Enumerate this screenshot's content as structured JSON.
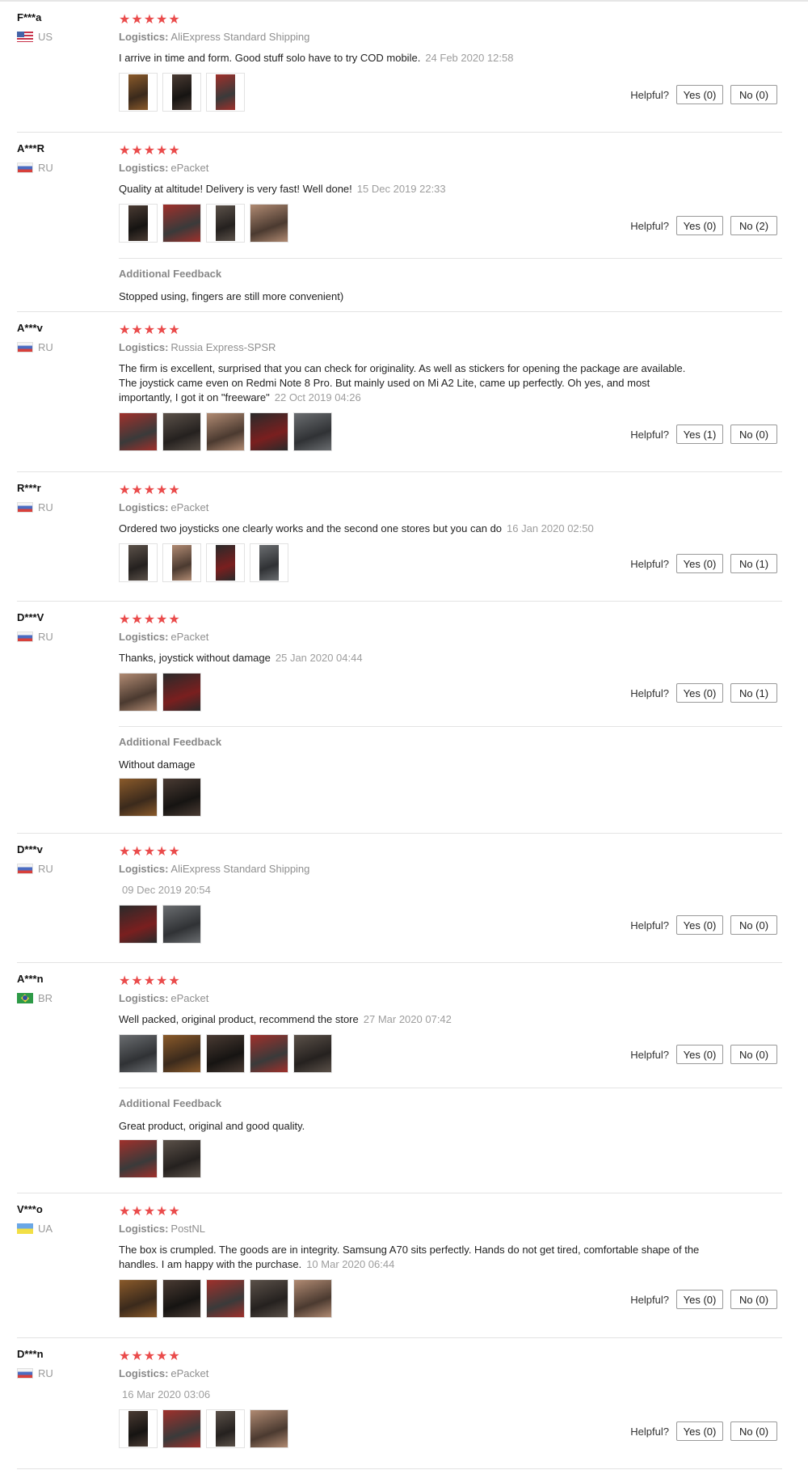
{
  "labels": {
    "logistics": "Logistics:",
    "helpful": "Helpful?",
    "additional_feedback": "Additional Feedback"
  },
  "colors": {
    "star": "#ea4b4b",
    "muted_text": "#9d9d9d",
    "divider": "#e3e3e3"
  },
  "reviews": [
    {
      "user": "F***a",
      "country": "US",
      "rating": 5,
      "logistics": "AliExpress Standard Shipping",
      "text": "I arrive in time and form. Good stuff solo have to try COD mobile.",
      "date": "24 Feb 2020 12:58",
      "photo_count": 3,
      "yes": "Yes (0)",
      "no": "No (0)"
    },
    {
      "user": "A***R",
      "country": "RU",
      "rating": 5,
      "logistics": "ePacket",
      "text": "Quality at altitude! Delivery is very fast! Well done!",
      "date": "15 Dec 2019 22:33",
      "photo_count": 4,
      "yes": "Yes (0)",
      "no": "No (2)",
      "additional": {
        "text": "Stopped using, fingers are still more convenient)",
        "photo_count": 0
      }
    },
    {
      "user": "A***v",
      "country": "RU",
      "rating": 5,
      "logistics": "Russia Express-SPSR",
      "text": "The firm is excellent, surprised that you can check for originality. As well as stickers for opening the package are available. The joystick came even on Redmi Note 8 Pro. But mainly used on Mi A2 Lite, came up perfectly. Oh yes, and most importantly, I got it on \"freeware\"",
      "date": "22 Oct 2019 04:26",
      "photo_count": 5,
      "yes": "Yes (1)",
      "no": "No (0)"
    },
    {
      "user": "R***r",
      "country": "RU",
      "rating": 5,
      "logistics": "ePacket",
      "text": "Ordered two joysticks one clearly works and the second one stores but you can do",
      "date": "16 Jan 2020 02:50",
      "photo_count": 4,
      "yes": "Yes (0)",
      "no": "No (1)"
    },
    {
      "user": "D***V",
      "country": "RU",
      "rating": 5,
      "logistics": "ePacket",
      "text": "Thanks, joystick without damage",
      "date": "25 Jan 2020 04:44",
      "photo_count": 2,
      "yes": "Yes (0)",
      "no": "No (1)",
      "additional": {
        "text": "Without damage",
        "photo_count": 2
      }
    },
    {
      "user": "D***v",
      "country": "RU",
      "rating": 5,
      "logistics": "AliExpress Standard Shipping",
      "text": "",
      "date": "09 Dec 2019 20:54",
      "photo_count": 2,
      "yes": "Yes (0)",
      "no": "No (0)"
    },
    {
      "user": "A***n",
      "country": "BR",
      "rating": 5,
      "logistics": "ePacket",
      "text": "Well packed, original product, recommend the store",
      "date": "27 Mar 2020 07:42",
      "photo_count": 5,
      "yes": "Yes (0)",
      "no": "No (0)",
      "additional": {
        "text": "Great product, original and good quality.",
        "photo_count": 2
      }
    },
    {
      "user": "V***o",
      "country": "UA",
      "rating": 5,
      "logistics": "PostNL",
      "text": "The box is crumpled. The goods are in integrity. Samsung A70 sits perfectly. Hands do not get tired, comfortable shape of the handles. I am happy with the purchase.",
      "date": "10 Mar 2020 06:44",
      "photo_count": 5,
      "yes": "Yes (0)",
      "no": "No (0)"
    },
    {
      "user": "D***n",
      "country": "RU",
      "rating": 5,
      "logistics": "ePacket",
      "text": "",
      "date": "16 Mar 2020 03:06",
      "photo_count": 4,
      "yes": "Yes (0)",
      "no": "No (0)"
    }
  ]
}
